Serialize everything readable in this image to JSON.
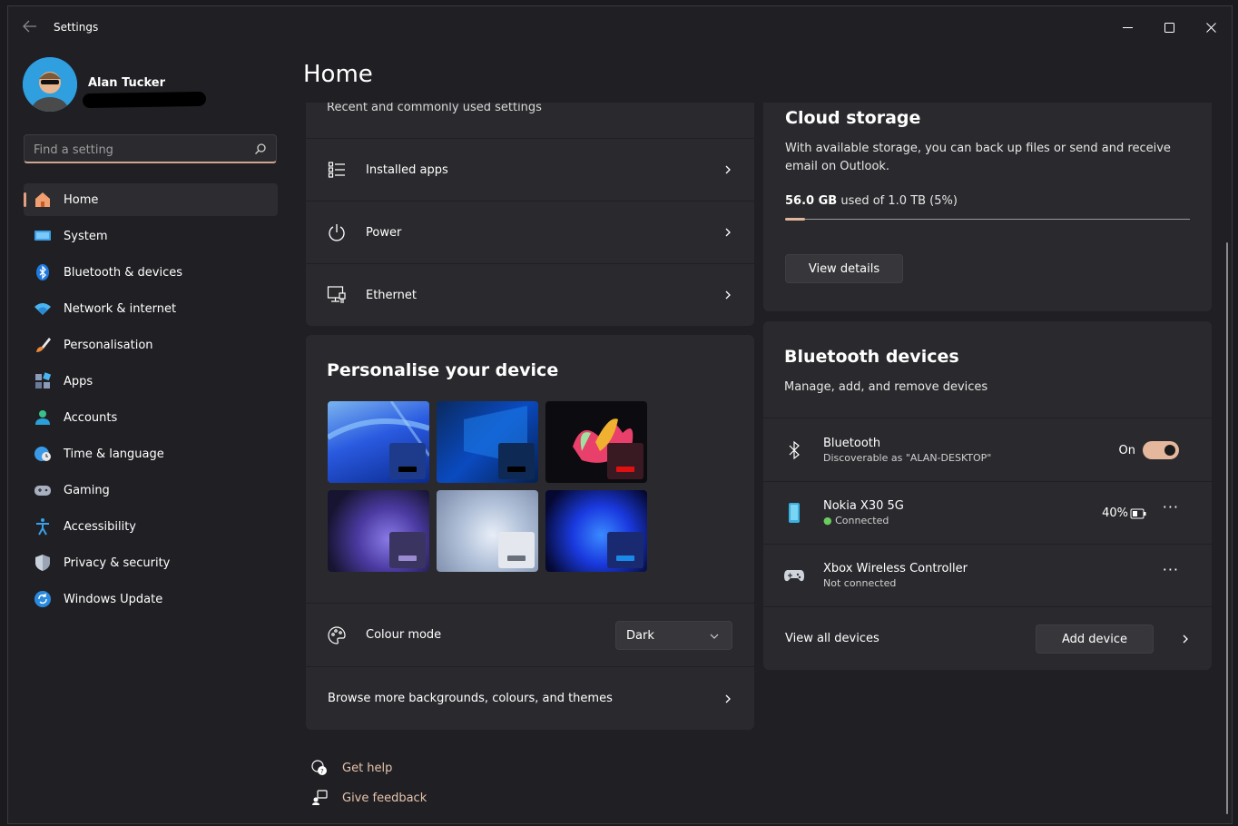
{
  "window": {
    "app_title": "Settings",
    "back_icon": "back-arrow-icon",
    "controls": [
      "minimize-icon",
      "maximize-icon",
      "close-icon"
    ]
  },
  "profile": {
    "name": "Alan Tucker"
  },
  "search": {
    "placeholder": "Find a setting"
  },
  "sidebar": {
    "items": [
      {
        "label": "Home",
        "icon": "home-icon",
        "active": true
      },
      {
        "label": "System",
        "icon": "system-icon"
      },
      {
        "label": "Bluetooth & devices",
        "icon": "bluetooth-icon"
      },
      {
        "label": "Network & internet",
        "icon": "wifi-icon"
      },
      {
        "label": "Personalisation",
        "icon": "brush-icon"
      },
      {
        "label": "Apps",
        "icon": "apps-icon"
      },
      {
        "label": "Accounts",
        "icon": "accounts-icon"
      },
      {
        "label": "Time & language",
        "icon": "globe-clock-icon"
      },
      {
        "label": "Gaming",
        "icon": "gamepad-icon"
      },
      {
        "label": "Accessibility",
        "icon": "accessibility-icon"
      },
      {
        "label": "Privacy & security",
        "icon": "shield-icon"
      },
      {
        "label": "Windows Update",
        "icon": "update-icon"
      }
    ]
  },
  "page": {
    "title": "Home"
  },
  "recommended": {
    "subtitle": "Recent and commonly used settings",
    "items": [
      {
        "label": "Installed apps",
        "icon": "installed-apps-icon"
      },
      {
        "label": "Power",
        "icon": "power-icon"
      },
      {
        "label": "Ethernet",
        "icon": "ethernet-icon"
      }
    ]
  },
  "personalise": {
    "title": "Personalise your device",
    "themes": [
      "theme-blue-glow",
      "theme-windows-10",
      "theme-flower",
      "theme-purple-bloom",
      "theme-light-bloom",
      "theme-blue-bloom"
    ],
    "colour_mode_label": "Colour mode",
    "colour_mode_value": "Dark",
    "browse_label": "Browse more backgrounds, colours, and themes"
  },
  "cloud": {
    "title": "Cloud storage",
    "description": "With available storage, you can back up files or send and receive email on Outlook.",
    "used_amount": "56.0 GB",
    "used_of": "used of 1.0 TB (5%)",
    "used_fraction": 0.05,
    "button": "View details"
  },
  "bluetooth": {
    "title": "Bluetooth devices",
    "description": "Manage, add, and remove devices",
    "toggle_label": "Bluetooth",
    "toggle_sub": "Discoverable as \"ALAN-DESKTOP\"",
    "toggle_state": "On",
    "devices": [
      {
        "name": "Nokia X30 5G",
        "status": "Connected",
        "battery": "40%",
        "icon": "phone-icon",
        "more": "···"
      },
      {
        "name": "Xbox Wireless Controller",
        "status": "Not connected",
        "icon": "controller-icon",
        "more": "···"
      }
    ],
    "view_all": "View all devices",
    "add_device": "Add device"
  },
  "footer": {
    "get_help": "Get help",
    "give_feedback": "Give feedback"
  }
}
